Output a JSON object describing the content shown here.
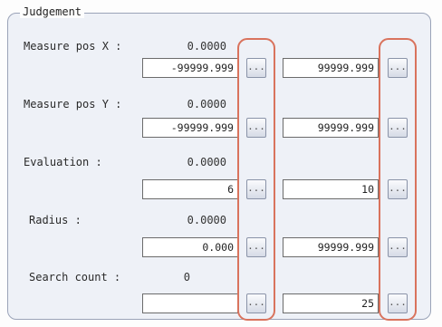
{
  "group": {
    "title": "Judgement"
  },
  "rows": [
    {
      "label": "Measure pos X :",
      "value": "0.0000",
      "lower": "-99999.999",
      "upper": "99999.999"
    },
    {
      "label": "Measure pos Y :",
      "value": "0.0000",
      "lower": "-99999.999",
      "upper": "99999.999"
    },
    {
      "label": "Evaluation :",
      "value": "0.0000",
      "lower": "6",
      "upper": "10"
    },
    {
      "label": "Radius :",
      "value": "0.0000",
      "lower": "0.000",
      "upper": "99999.999"
    },
    {
      "label": "Search count :",
      "value": "0",
      "lower": "",
      "upper": "25"
    }
  ],
  "button_label": "...",
  "highlight_color": "#d9735d"
}
